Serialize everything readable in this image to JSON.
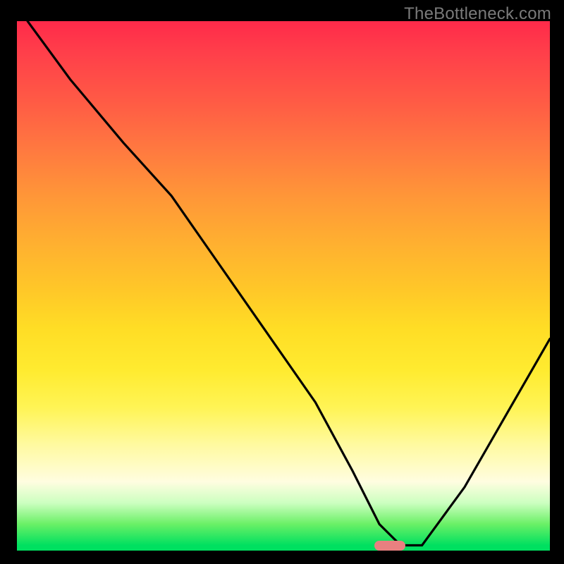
{
  "watermark": "TheBottleneck.com",
  "chart_data": {
    "type": "line",
    "title": "",
    "xlabel": "",
    "ylabel": "",
    "xlim": [
      0,
      100
    ],
    "ylim": [
      0,
      100
    ],
    "series": [
      {
        "name": "bottleneck-curve",
        "x": [
          2,
          10,
          20,
          29,
          38,
          47,
          56,
          63,
          68,
          72,
          76,
          84,
          92,
          100
        ],
        "values": [
          100,
          89,
          77,
          67,
          54,
          41,
          28,
          15,
          5,
          1,
          1,
          12,
          26,
          40
        ]
      }
    ],
    "marker": {
      "x": 70,
      "y": 0.5,
      "color": "#e98080",
      "shape": "pill"
    },
    "gradient_stops": [
      {
        "pct": 0,
        "color": "#ff2a4a"
      },
      {
        "pct": 50,
        "color": "#ffdd25"
      },
      {
        "pct": 88,
        "color": "#fffde0"
      },
      {
        "pct": 99,
        "color": "#00e060"
      }
    ]
  }
}
